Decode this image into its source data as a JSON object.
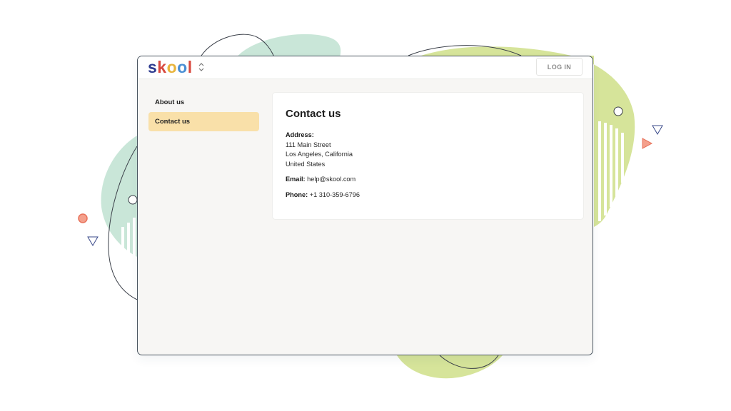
{
  "app": {
    "logo_letters": [
      {
        "char": "s",
        "color": "#2e3b8f"
      },
      {
        "char": "k",
        "color": "#d8483e"
      },
      {
        "char": "o",
        "color": "#e8b43c"
      },
      {
        "char": "o",
        "color": "#4a8fd4"
      },
      {
        "char": "l",
        "color": "#d8483e"
      }
    ],
    "switcher_icon": "chevron-up-down-icon",
    "login_label": "LOG IN"
  },
  "sidebar": {
    "items": [
      {
        "label": "About us",
        "active": false
      },
      {
        "label": "Contact us",
        "active": true
      }
    ],
    "active_color": "#f9e0a9"
  },
  "contact": {
    "title": "Contact us",
    "address_label": "Address:",
    "address_lines": [
      "111 Main Street",
      "Los Angeles, California",
      "United States"
    ],
    "email_label": "Email:",
    "email_value": "help@skool.com",
    "phone_label": "Phone:",
    "phone_value": "+1 310-359-6796"
  },
  "colors": {
    "mint_blob": "#c9e6d8",
    "lime_blob": "#d6e49a",
    "outline": "#3a3f48",
    "accent_red": "#e8735c",
    "accent_navy": "#3a4a8a"
  }
}
